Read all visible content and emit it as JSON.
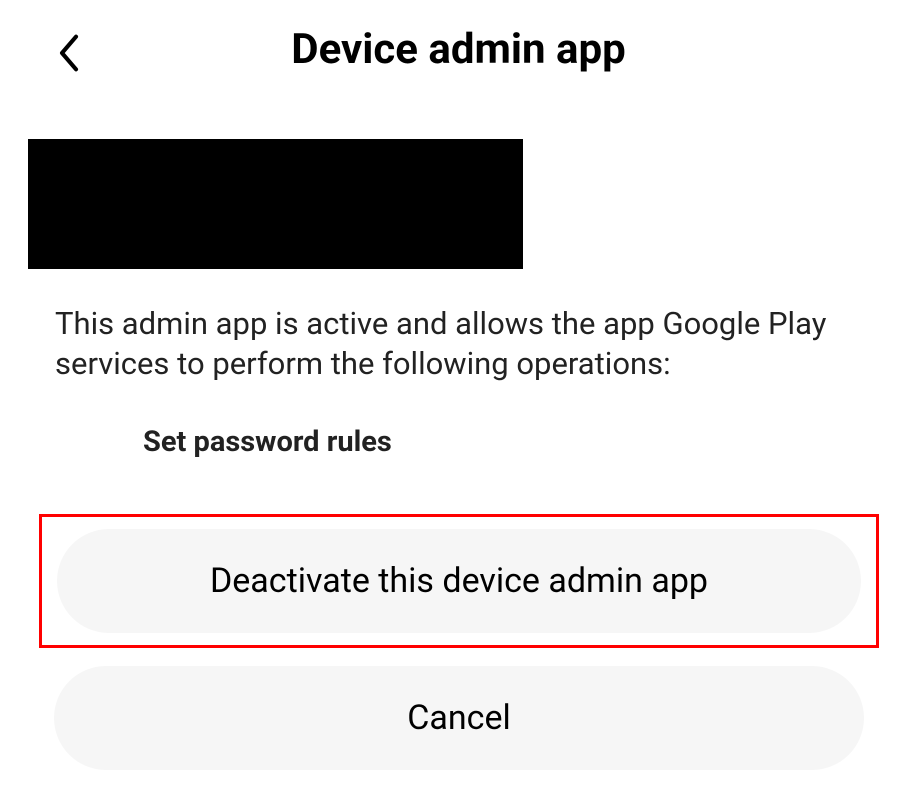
{
  "header": {
    "title": "Device admin app"
  },
  "description": "This admin app is active and allows the app Google Play services to perform the following operations:",
  "operations": {
    "item1": "Set password rules"
  },
  "buttons": {
    "deactivate": "Deactivate this device admin app",
    "cancel": "Cancel"
  }
}
